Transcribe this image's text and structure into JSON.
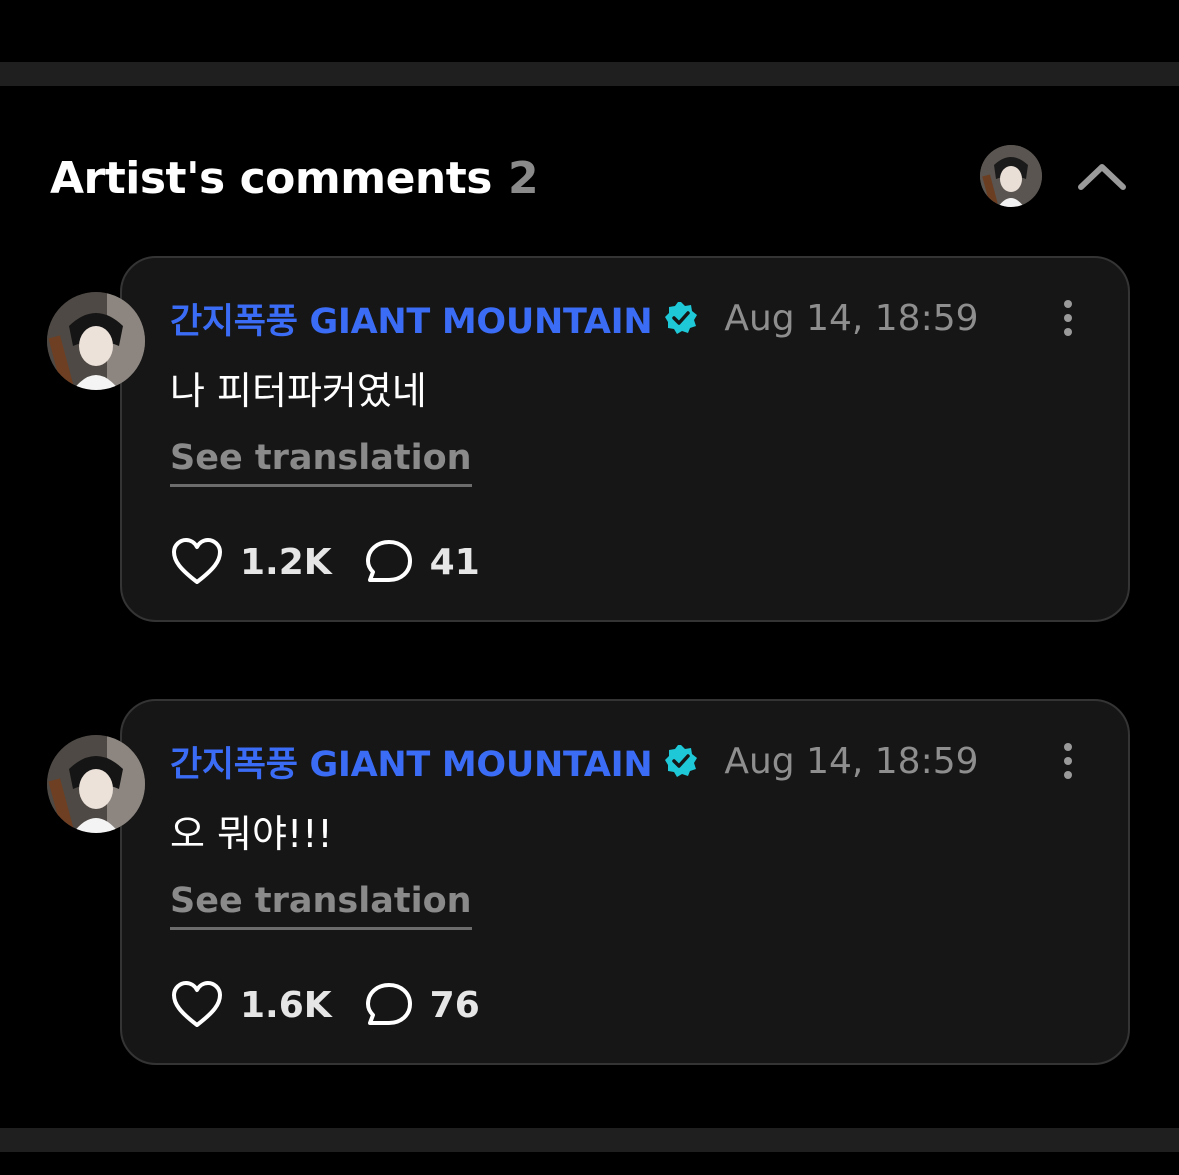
{
  "section": {
    "title": "Artist's comments",
    "count": "2"
  },
  "colors": {
    "background": "#000000",
    "card": "#161616",
    "author": "#3b6cf5",
    "verified": "#1ec8d6",
    "muted": "#8a8a8a"
  },
  "icons": {
    "collapse": "chevron-up-icon",
    "verified": "verified-badge-icon",
    "like": "heart-icon",
    "reply": "speech-bubble-icon",
    "more": "more-vertical-icon"
  },
  "comments": [
    {
      "author": "간지폭풍 GIANT MOUNTAIN",
      "date": "Aug 14, 18:59",
      "text": "나 피터파커였네",
      "translate_label": "See translation",
      "likes": "1.2K",
      "replies": "41"
    },
    {
      "author": "간지폭풍 GIANT MOUNTAIN",
      "date": "Aug 14, 18:59",
      "text": "오 뭐야!!!",
      "translate_label": "See translation",
      "likes": "1.6K",
      "replies": "76"
    }
  ]
}
